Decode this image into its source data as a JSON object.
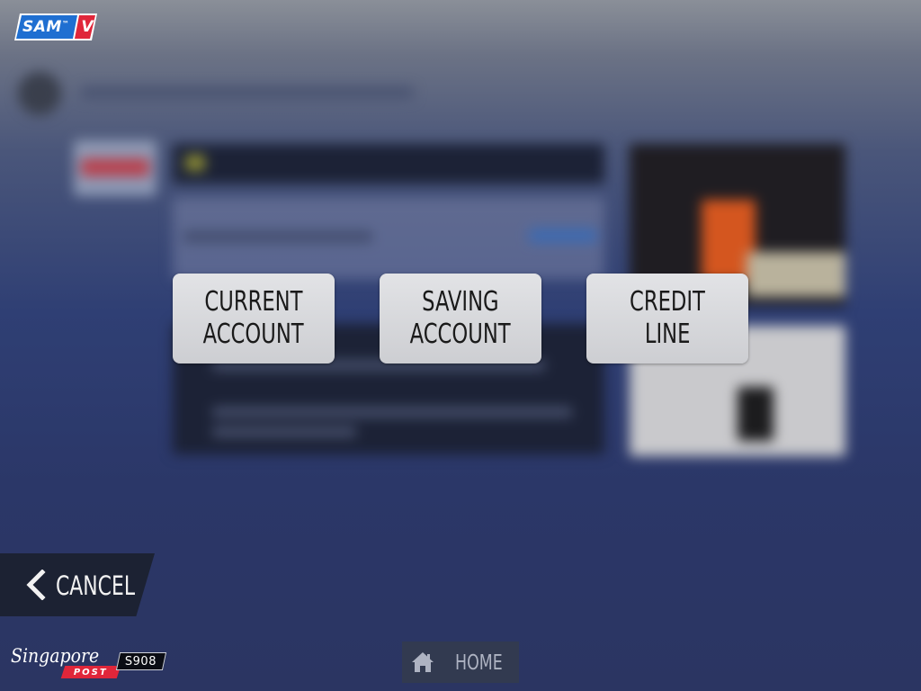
{
  "brand": {
    "logo_text": "SAM",
    "logo_trademark": "™",
    "logo_suffix": "V",
    "logo_colors": {
      "blue": "#1f6fd1",
      "red": "#e0263a"
    }
  },
  "options": [
    {
      "line1": "CURRENT",
      "line2": "ACCOUNT"
    },
    {
      "line1": "SAVING",
      "line2": "ACCOUNT"
    },
    {
      "line1": "CREDIT",
      "line2": "LINE"
    }
  ],
  "navigation": {
    "cancel_label": "CANCEL",
    "home_label": "HOME",
    "cancel_icon": "chevron-left-icon",
    "home_icon": "home-icon"
  },
  "footer": {
    "singpost_script": "Singapore",
    "singpost_post": "POST",
    "station_id": "S908"
  },
  "colors": {
    "button_bg": "#d6d7da",
    "cancel_bg": "#1c2233",
    "home_bg": "#323a50",
    "singpost_red": "#e0263a"
  }
}
